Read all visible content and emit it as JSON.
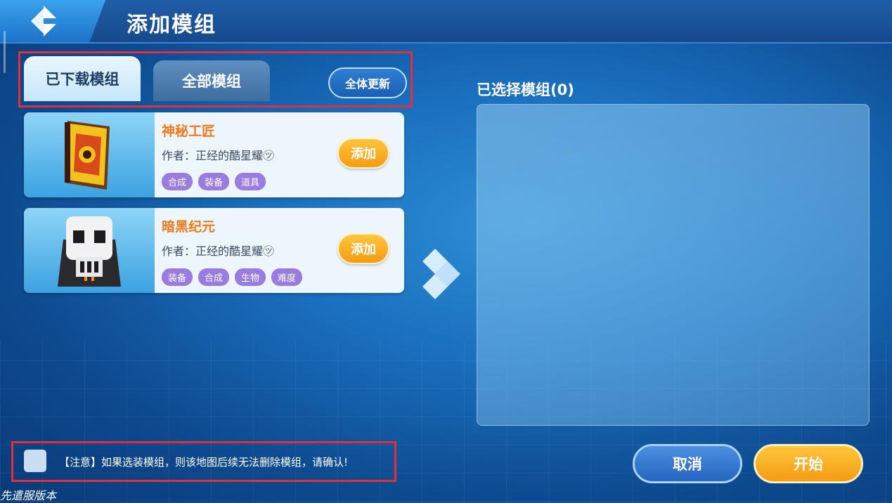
{
  "header": {
    "title": "添加模组",
    "back_icon": "back-diamond-icon"
  },
  "tabs": [
    {
      "label": "已下载模组",
      "active": true
    },
    {
      "label": "全部模组",
      "active": false
    }
  ],
  "update_all_label": "全体更新",
  "mods": [
    {
      "name": "神秘工匠",
      "author": "作者：正经的酷星耀㋡",
      "add_label": "添加",
      "tags": [
        "合成",
        "装备",
        "道具"
      ],
      "icon": "spellbook-icon"
    },
    {
      "name": "暗黑纪元",
      "author": "作者：正经的酷星耀㋡",
      "add_label": "添加",
      "tags": [
        "装备",
        "合成",
        "生物",
        "难度"
      ],
      "icon": "skull-icon"
    }
  ],
  "selected": {
    "title": "已选择模组(0)"
  },
  "notice": {
    "text": "【注意】如果选装模组，则该地图后续无法删除模组，请确认!"
  },
  "buttons": {
    "cancel": "取消",
    "start": "开始"
  },
  "version_label": "先遣服版本",
  "colors": {
    "accent_orange": "#f59b12",
    "tag_purple": "#9a7ce0",
    "highlight_red": "#e0303a"
  }
}
